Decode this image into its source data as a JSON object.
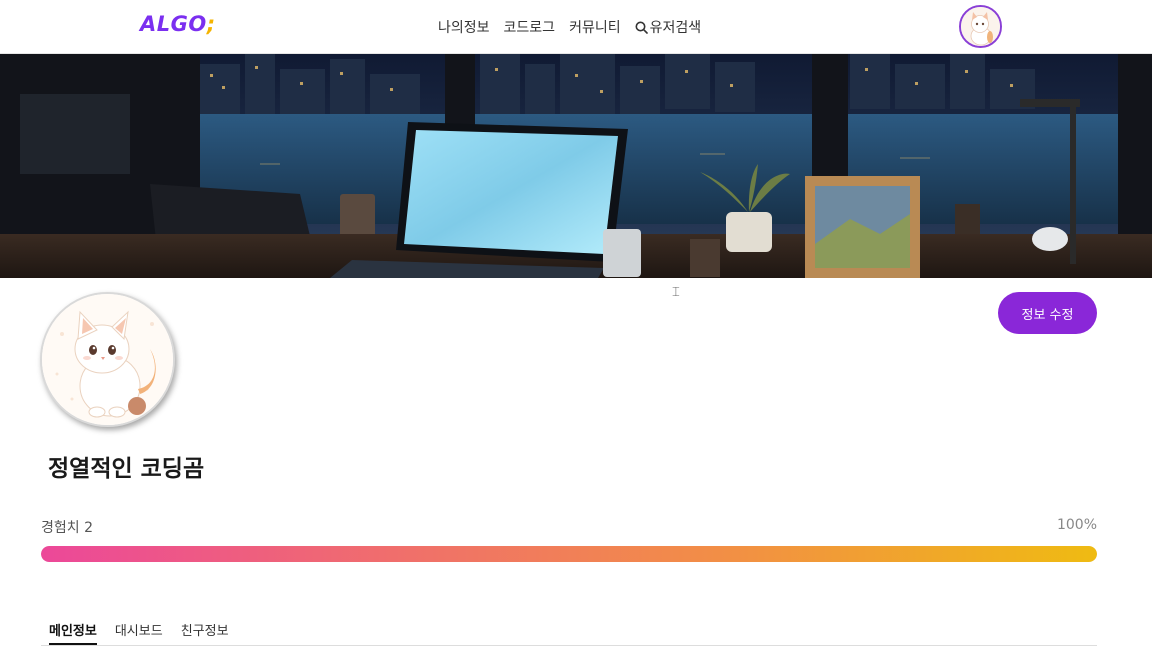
{
  "header": {
    "logo_main": "ALGO",
    "logo_accent": ";",
    "nav": [
      "나의정보",
      "코드로그",
      "커뮤니티"
    ],
    "search_label": "유저검색",
    "search_icon": "search-icon",
    "avatar_icon": "cat-avatar-icon"
  },
  "banner": {
    "description_icon": "night-city-desk-illustration"
  },
  "profile": {
    "avatar_icon": "cat-avatar-icon",
    "edit_label": "정보 수정",
    "nickname": "정열적인 코딩곰"
  },
  "experience": {
    "label": "경험치 2",
    "percent_text": "100%",
    "progress": 1.0,
    "gradient": [
      "#ec4899",
      "#f0706a",
      "#f28f45",
      "#efbb12"
    ]
  },
  "tabs": [
    {
      "label": "메인정보",
      "active": true
    },
    {
      "label": "대시보드",
      "active": false
    },
    {
      "label": "친구정보",
      "active": false
    }
  ],
  "colors": {
    "accent": "#8a27d8",
    "logo": "#7b2ff0",
    "logo_dot": "#f5b400"
  }
}
